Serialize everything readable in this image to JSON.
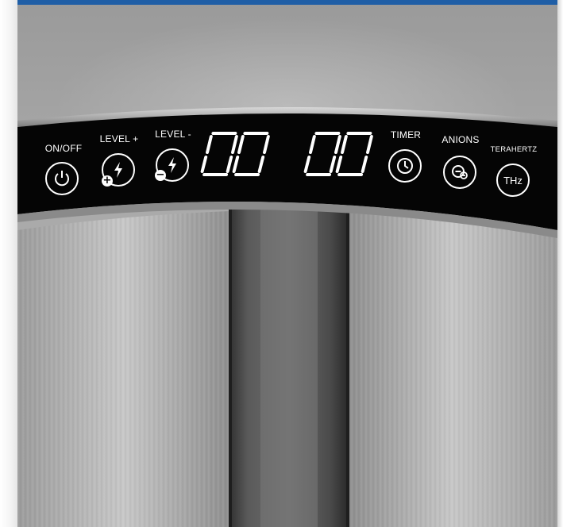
{
  "controls": {
    "power_label": "ON/OFF",
    "level_up_label": "LEVEL +",
    "level_down_label": "LEVEL -",
    "timer_label": "TIMER",
    "anions_label": "ANIONS",
    "terahertz_label": "TERAHERTZ",
    "terahertz_button_text": "THz"
  },
  "icons": [
    "power-icon",
    "lightning-plus-icon",
    "lightning-minus-icon",
    "clock-icon",
    "anion-icon"
  ],
  "colors": {
    "panel": "#000000",
    "top_strip": "#1f5ea6",
    "housing": "#a8a8a8"
  }
}
